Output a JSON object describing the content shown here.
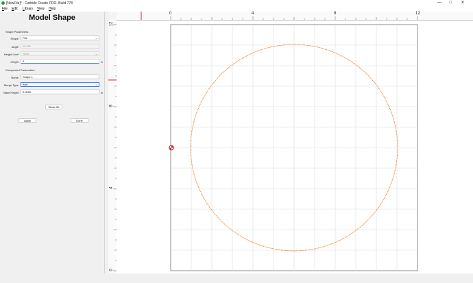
{
  "window": {
    "title": "[NewFile]* - Carbide Create PRO, Build 778",
    "minimize": "—",
    "maximize": "☐",
    "close": "✕"
  },
  "menu": [
    "File",
    "Edit",
    "Library",
    "View",
    "Help"
  ],
  "panel": {
    "title": "Model Shape",
    "shape_params_label": "Shape Parameters",
    "shape": {
      "label": "Shape",
      "value": "Flat"
    },
    "angle": {
      "label": "Angle",
      "value": "45.000"
    },
    "height_limit": {
      "label": "Height Limit",
      "value": "None"
    },
    "height": {
      "label": "Height",
      "value": "0",
      "unit": "in"
    },
    "component_params_label": "Component Parameters",
    "name": {
      "label": "Name",
      "value": "Shape 1"
    },
    "merge_type": {
      "label": "Merge Type",
      "value": "Add"
    },
    "base_height": {
      "label": "Base Height",
      "value": "0.0000",
      "unit": "in"
    },
    "show3d_label": "Show 3D",
    "apply_label": "Apply",
    "done_label": "Done"
  },
  "ruler_top_labels": [
    "0",
    "4",
    "8",
    "12"
  ],
  "ruler_left_labels": [
    "12",
    "8",
    "4",
    "0"
  ],
  "colors": {
    "circle": "#f07a2a",
    "grid": "#dcdcdc",
    "marker": "#e02020"
  }
}
